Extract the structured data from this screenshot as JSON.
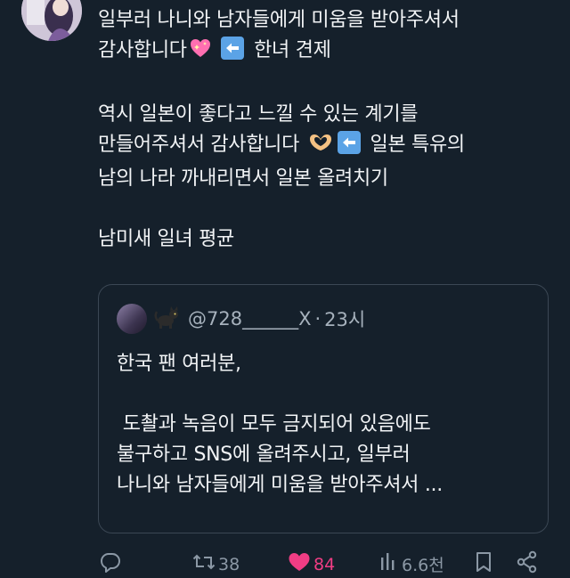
{
  "tweet": {
    "lines": [
      "일부러 나니와 남자들에게 미움을 받아주셔서",
      "감사합니다",
      "한녀 견제",
      "역시 일본이 좋다고 느낄 수 있는 계기를",
      "만들어주셔서 감사합니다",
      "일본 특유의",
      "남의 나라 까내리면서 일본 올려치기",
      "남미새 일녀 평균"
    ],
    "icons": [
      "sparkling-heart-icon",
      "left-arrow-icon",
      "heart-hands-icon"
    ]
  },
  "quote": {
    "handle": "@728______X",
    "separator": "·",
    "time": "23시",
    "lines": [
      "한국 팬 여러분,",
      " 도촬과 녹음이 모두 금지되어 있음에도",
      "불구하고 SNS에 올려주시고, 일부러",
      "나니와 남자들에게 미움을 받아주셔서 ..."
    ]
  },
  "actions": {
    "replies": "",
    "retweets": "38",
    "likes": "84",
    "views": "6.6천"
  },
  "colors": {
    "background": "#15202b",
    "text": "#f1f3f5",
    "muted": "#8b98a5",
    "like": "#f03d84",
    "border": "#3b4754"
  }
}
